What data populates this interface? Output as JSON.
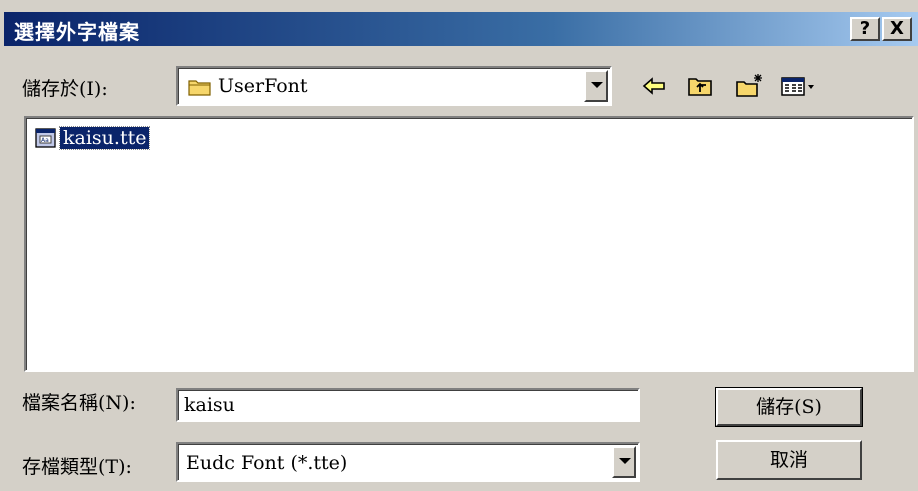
{
  "dialog": {
    "title": "選擇外字檔案",
    "help_button": "?",
    "close_button": "X"
  },
  "save_in": {
    "label": "儲存於(I):",
    "value": "UserFont",
    "folder_icon": "folder-icon"
  },
  "toolbar": {
    "back_icon": "back-arrow-icon",
    "up_icon": "up-folder-icon",
    "new_folder_icon": "new-folder-icon",
    "view_menu_icon": "view-menu-icon"
  },
  "files": [
    {
      "name": "kaisu.tte",
      "icon": "font-file-icon",
      "selected": true
    }
  ],
  "filename": {
    "label": "檔案名稱(N):",
    "value": "kaisu"
  },
  "filetype": {
    "label": "存檔類型(T):",
    "value": "Eudc Font (*.tte)"
  },
  "buttons": {
    "save": "儲存(S)",
    "cancel": "取消"
  },
  "colors": {
    "title_bar": "#0a246a",
    "dialog_bg": "#d4d0c8",
    "selection": "#0a246a"
  }
}
